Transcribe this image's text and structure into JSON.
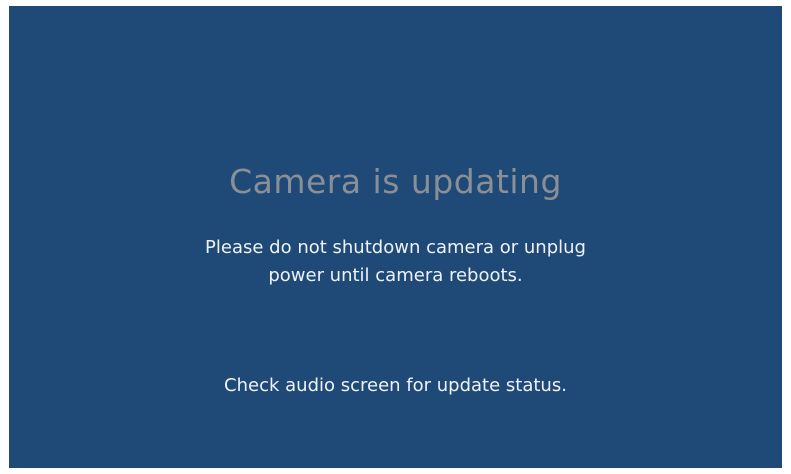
{
  "screen": {
    "title": "Camera is updating",
    "message_line1": "Please do not shutdown camera or unplug",
    "message_line2": "power until camera reboots.",
    "status_hint": "Check audio screen for update status."
  },
  "colors": {
    "background": "#1f4a78",
    "title": "#8a8f95",
    "text": "#eef2f6"
  }
}
